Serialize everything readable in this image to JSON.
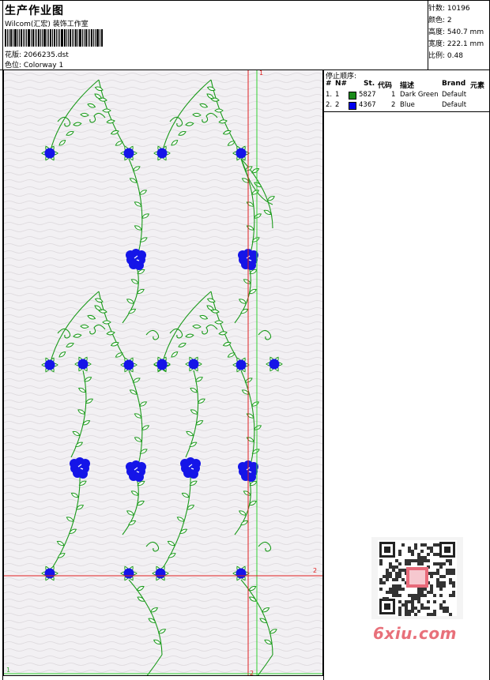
{
  "header": {
    "title": "生产作业图",
    "company": "Wilcom(汇宏) 装饰工作室",
    "design_label": "花版:",
    "design_value": "2066235.dst",
    "colorway_label": "色位:",
    "colorway_value": "Colorway 1"
  },
  "specs": [
    {
      "label": "针数:",
      "value": "10196"
    },
    {
      "label": "颜色:",
      "value": "2"
    },
    {
      "label": "高度:",
      "value": "540.7 mm"
    },
    {
      "label": "宽度:",
      "value": "222.1 mm"
    },
    {
      "label": "比例:",
      "value": "0.48"
    }
  ],
  "stop_table": {
    "title": "停止顺序:",
    "headers": {
      "num": "#",
      "n": "N#",
      "st": "St.",
      "code": "代码",
      "desc": "描述",
      "brand": "Brand",
      "elem": "元素"
    },
    "rows": [
      {
        "num": "1.",
        "n": "1",
        "color": "#1a8a1a",
        "st": "5827",
        "code": "1",
        "desc": "Dark Green",
        "brand": "Default"
      },
      {
        "num": "2.",
        "n": "2",
        "color": "#0000ee",
        "st": "4367",
        "code": "2",
        "desc": "Blue",
        "brand": "Default"
      }
    ]
  },
  "guides": {
    "marker_1": "1",
    "marker_2": "2"
  },
  "colors": {
    "leaf_green": "#1a9a1a",
    "flower_blue": "#1515e8",
    "guide_red": "#e02020",
    "guide_green": "#30d030",
    "watermark": "#e8707a"
  },
  "watermark": "6xiu.com",
  "qr_icon": "qr-code-icon"
}
